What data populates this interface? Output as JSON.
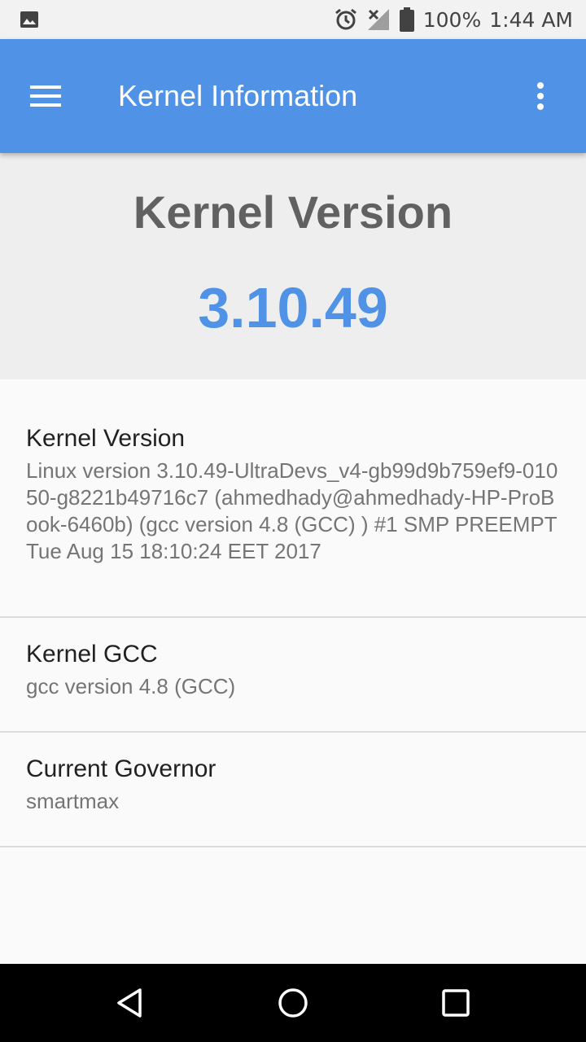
{
  "status_bar": {
    "battery_text": "100%",
    "time": "1:44 AM",
    "icons": [
      "image-icon",
      "alarm-icon",
      "no-signal-icon",
      "battery-icon"
    ]
  },
  "app_bar": {
    "title": "Kernel Information",
    "color": "#4f92e6"
  },
  "hero": {
    "title": "Kernel Version",
    "version": "3.10.49"
  },
  "items": [
    {
      "title": "Kernel Version",
      "value": "Linux version 3.10.49-UltraDevs_v4-gb99d9b759ef9-01050-g8221b49716c7 (ahmedhady@ahmedhady-HP-ProBook-6460b) (gcc version 4.8 (GCC) ) #1 SMP PREEMPT Tue Aug 15 18:10:24 EET 2017"
    },
    {
      "title": "Kernel GCC",
      "value": "gcc version 4.8 (GCC)"
    },
    {
      "title": "Current Governor",
      "value": "smartmax"
    }
  ],
  "nav_bar": {
    "icons": [
      "back-icon",
      "home-icon",
      "recents-icon"
    ]
  }
}
